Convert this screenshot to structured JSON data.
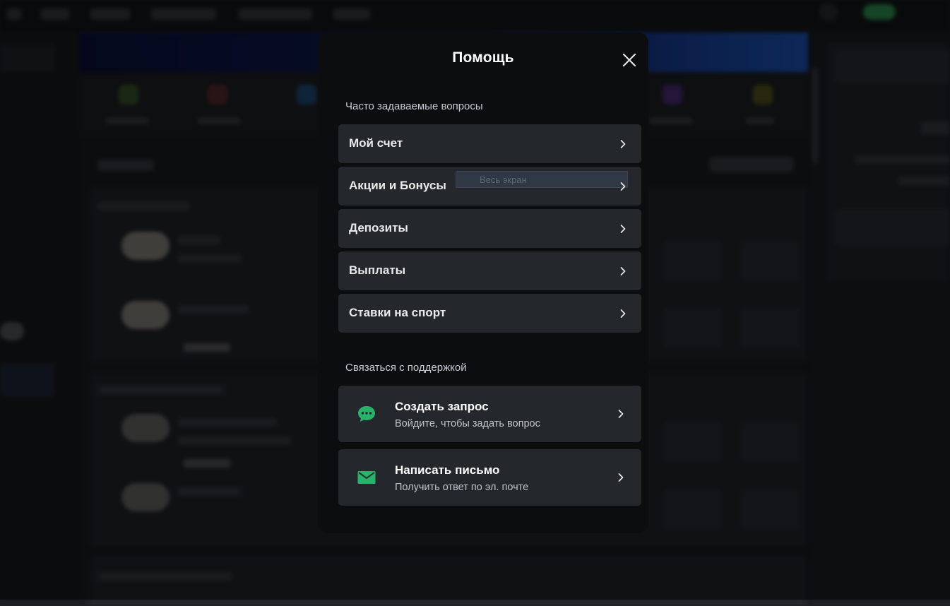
{
  "modal": {
    "title": "Помощь",
    "faq_section_label": "Часто задаваемые вопросы",
    "faq_items": [
      {
        "label": "Мой счет"
      },
      {
        "label": "Акции и Бонусы"
      },
      {
        "label": "Депозиты"
      },
      {
        "label": "Выплаты"
      },
      {
        "label": "Ставки на спорт"
      }
    ],
    "overlay_tooltip": "Весь экран",
    "support_section_label": "Связаться с поддержкой",
    "support_items": [
      {
        "title": "Создать запрос",
        "subtitle": "Войдите, чтобы задать вопрос",
        "icon": "chat-bubble-icon"
      },
      {
        "title": "Написать письмо",
        "subtitle": "Получить ответ по эл. почте",
        "icon": "envelope-icon"
      }
    ]
  },
  "colors": {
    "accent_green": "#27b36a",
    "modal_bg": "#0c0d0f",
    "item_bg": "#24272c",
    "backdrop_banner": "#1d59c2"
  }
}
